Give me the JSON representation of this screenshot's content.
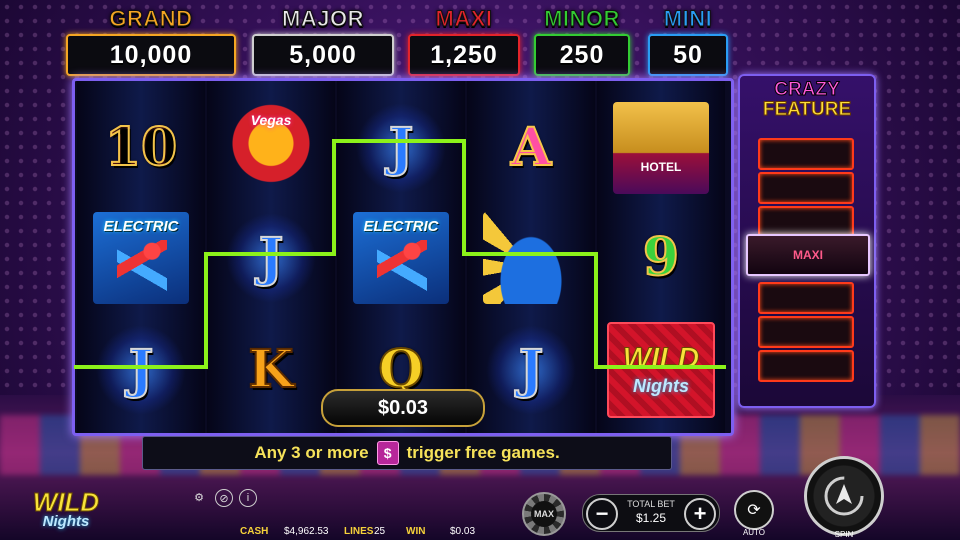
{
  "jackpots": [
    {
      "label": "GRAND",
      "value": "10,000",
      "color": "#f5a623"
    },
    {
      "label": "MAJOR",
      "value": "5,000",
      "color": "#e8e8e8"
    },
    {
      "label": "MAXI",
      "value": "1,250",
      "color": "#e3242b"
    },
    {
      "label": "MINOR",
      "value": "250",
      "color": "#33cc33"
    },
    {
      "label": "MINI",
      "value": "50",
      "color": "#2a9df4"
    }
  ],
  "reels": [
    [
      "10",
      "ELECTRIC",
      "J"
    ],
    [
      "Vegas",
      "J",
      "K"
    ],
    [
      "J",
      "ELECTRIC",
      "Q"
    ],
    [
      "A",
      "feather-showgirl",
      "J"
    ],
    [
      "HOTEL",
      "9",
      "WILD Nights"
    ]
  ],
  "win_amount": "$0.03",
  "crazy_feature": {
    "title_line1": "CRAZY",
    "title_line2": "FEATURE",
    "active_label": "MAXI"
  },
  "info_message": {
    "before": "Any 3 or more",
    "icon": "dollar-scatter-icon",
    "symbol": "$",
    "after": "trigger free games."
  },
  "logo": {
    "top": "WILD",
    "bottom": "Nights"
  },
  "bottom_bar": {
    "cash_label": "CASH",
    "cash_value": "$4,962.53",
    "lines_label": "LINES",
    "lines_value": "25",
    "win_label": "WIN",
    "win_value": "$0.03"
  },
  "controls": {
    "max_label": "MAX",
    "total_bet_label": "TOTAL BET",
    "total_bet_value": "$1.25",
    "minus": "−",
    "plus": "+",
    "auto_label": "AUTO",
    "spin_label": "SPIN"
  },
  "accent_color": "#8cf21a"
}
